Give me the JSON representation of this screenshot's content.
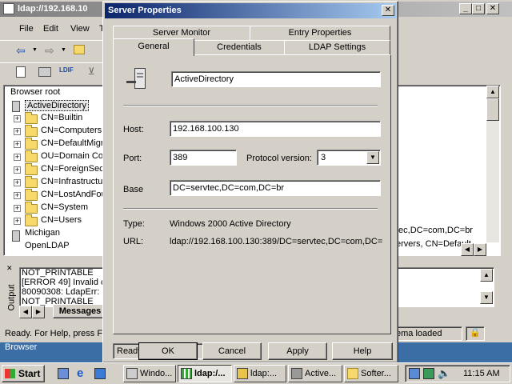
{
  "main_window": {
    "title": "ldap://192.168.10",
    "menu": [
      "File",
      "Edit",
      "View",
      "T"
    ],
    "tree": {
      "root": "Browser root",
      "items": [
        "ActiveDirectory",
        "CN=Builtin",
        "CN=Computers",
        "CN=DefaultMigr",
        "OU=Domain Cor",
        "CN=ForeignSec",
        "CN=Infrastructu",
        "CN=LostAndFou",
        "CN=System",
        "CN=Users",
        "Michigan",
        "OpenLDAP"
      ]
    },
    "right_fragments": [
      "tec,DC=com,DC=br",
      "ervers, CN=Default"
    ],
    "output": {
      "side_label": "Output",
      "lines": [
        "NOT_PRINTABLE",
        "[ERROR 49] Invalid c",
        "80090308: LdapErr: D",
        "NOT_PRINTABLE"
      ],
      "tab": "Messages"
    },
    "status_left": "Ready. For Help, press F1",
    "status_right": "ema loaded",
    "bottom_left": "Browser"
  },
  "dialog": {
    "title": "Server Properties",
    "tabs_back": [
      "Server Monitor",
      "Entry Properties"
    ],
    "tabs_front": [
      "General",
      "Credentials",
      "LDAP Settings"
    ],
    "name_value": "ActiveDirectory",
    "host_label": "Host:",
    "host_value": "192.168.100.130",
    "port_label": "Port:",
    "port_value": "389",
    "protocol_label": "Protocol version:",
    "protocol_value": "3",
    "base_label": "Base",
    "base_value": "DC=servtec,DC=com,DC=br",
    "type_label": "Type:",
    "type_value": "Windows 2000 Active Directory",
    "url_label": "URL:",
    "url_value": "ldap://192.168.100.130:389/DC=servtec,DC=com,DC=",
    "status": "Ready",
    "buttons": {
      "ok": "OK",
      "cancel": "Cancel",
      "apply": "Apply",
      "help": "Help"
    }
  },
  "taskbar": {
    "start": "Start",
    "tasks": [
      "Windo...",
      "ldap:/...",
      "ldap:...",
      "Active...",
      "Softer..."
    ],
    "clock": "11:15 AM"
  },
  "colors": {
    "title_active": "#0a246a",
    "face": "#d4d0c8",
    "desktop": "#3a6ea5"
  }
}
